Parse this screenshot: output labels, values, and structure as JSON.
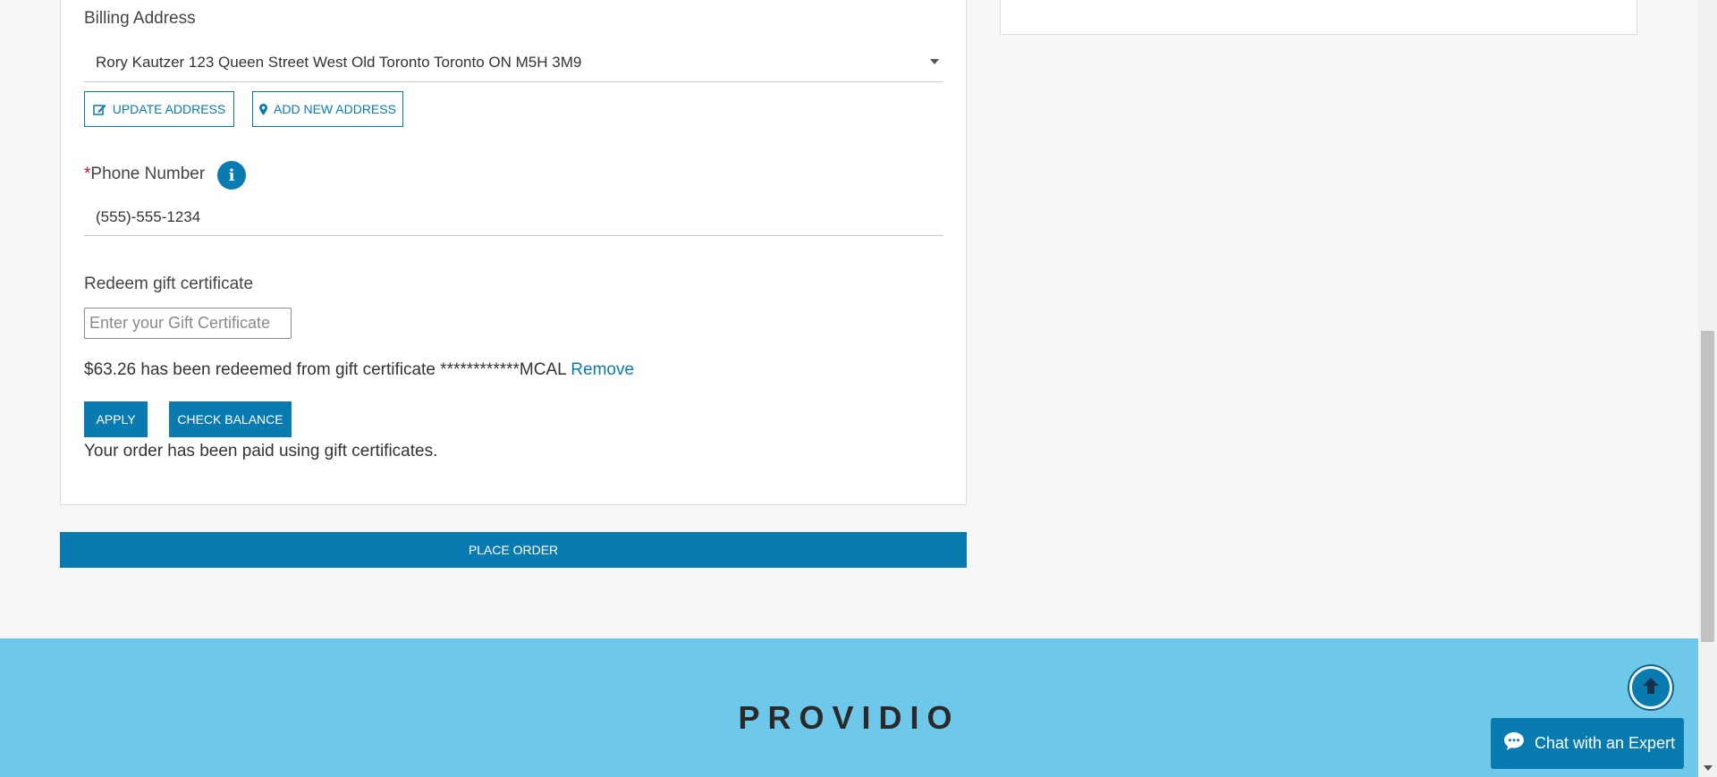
{
  "billing": {
    "label": "Billing Address",
    "selected_address": "Rory Kautzer 123 Queen Street West Old Toronto Toronto ON M5H 3M9",
    "update_label": "UPDATE ADDRESS",
    "add_label": "ADD NEW ADDRESS"
  },
  "phone": {
    "required_mark": "*",
    "label": "Phone Number",
    "info_glyph": "i",
    "value": "(555)-555-1234"
  },
  "gift": {
    "label": "Redeem gift certificate",
    "placeholder": "Enter your Gift Certificate",
    "redeemed_message": "$63.26 has been redeemed from gift certificate ************MCAL",
    "remove_label": "Remove",
    "apply_label": "APPLY",
    "check_balance_label": "CHECK BALANCE",
    "paid_message": "Your order has been paid using gift certificates."
  },
  "place_order_label": "PLACE ORDER",
  "footer": {
    "brand": "PROVIDIO"
  },
  "chat": {
    "label": "Chat with an Expert"
  },
  "icons": {
    "update": "edit-icon",
    "add": "map-pin-icon",
    "info": "info-icon",
    "scroll_top": "arrow-up-icon",
    "chat": "chat-bubble-icon"
  },
  "colors": {
    "accent": "#0a7bb0",
    "footer_bg": "#6ec8ea",
    "required": "#c8102e"
  }
}
